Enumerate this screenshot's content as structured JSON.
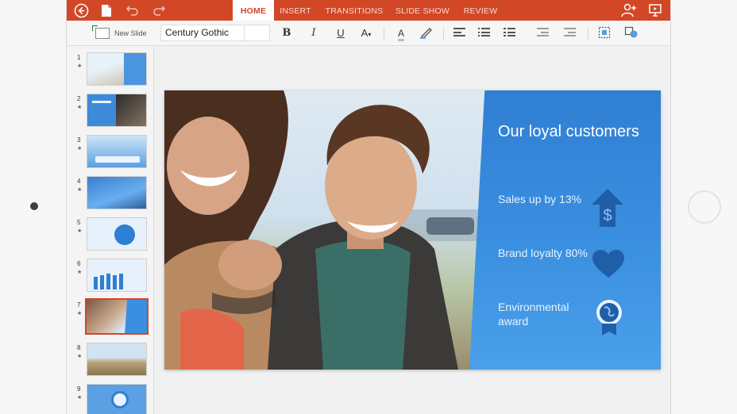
{
  "ribbon": {
    "tabs": [
      {
        "label": "HOME",
        "active": true
      },
      {
        "label": "INSERT",
        "active": false
      },
      {
        "label": "TRANSITIONS",
        "active": false
      },
      {
        "label": "SLIDE SHOW",
        "active": false
      },
      {
        "label": "REVIEW",
        "active": false
      }
    ],
    "accent_color": "#d24726"
  },
  "toolbar": {
    "new_slide_label": "New Slide",
    "font_name": "Century Gothic",
    "bold": "B",
    "italic": "I",
    "underline": "U",
    "font_size_glyph": "A",
    "font_color_glyph": "A"
  },
  "thumbnails": [
    {
      "number": "1",
      "star": "★"
    },
    {
      "number": "2",
      "star": "★"
    },
    {
      "number": "3",
      "star": "★"
    },
    {
      "number": "4",
      "star": "★"
    },
    {
      "number": "5",
      "star": "★"
    },
    {
      "number": "6",
      "star": "★"
    },
    {
      "number": "7",
      "star": "★",
      "selected": true
    },
    {
      "number": "8",
      "star": "★"
    },
    {
      "number": "9",
      "star": "★"
    }
  ],
  "slide": {
    "title": "Our loyal customers",
    "items": [
      {
        "text": "Sales up by 13%",
        "icon": "dollar-arrow-icon"
      },
      {
        "text": "Brand loyalty 80%",
        "icon": "heart-icon"
      },
      {
        "text": "Environmental award",
        "icon": "globe-award-icon"
      }
    ]
  }
}
